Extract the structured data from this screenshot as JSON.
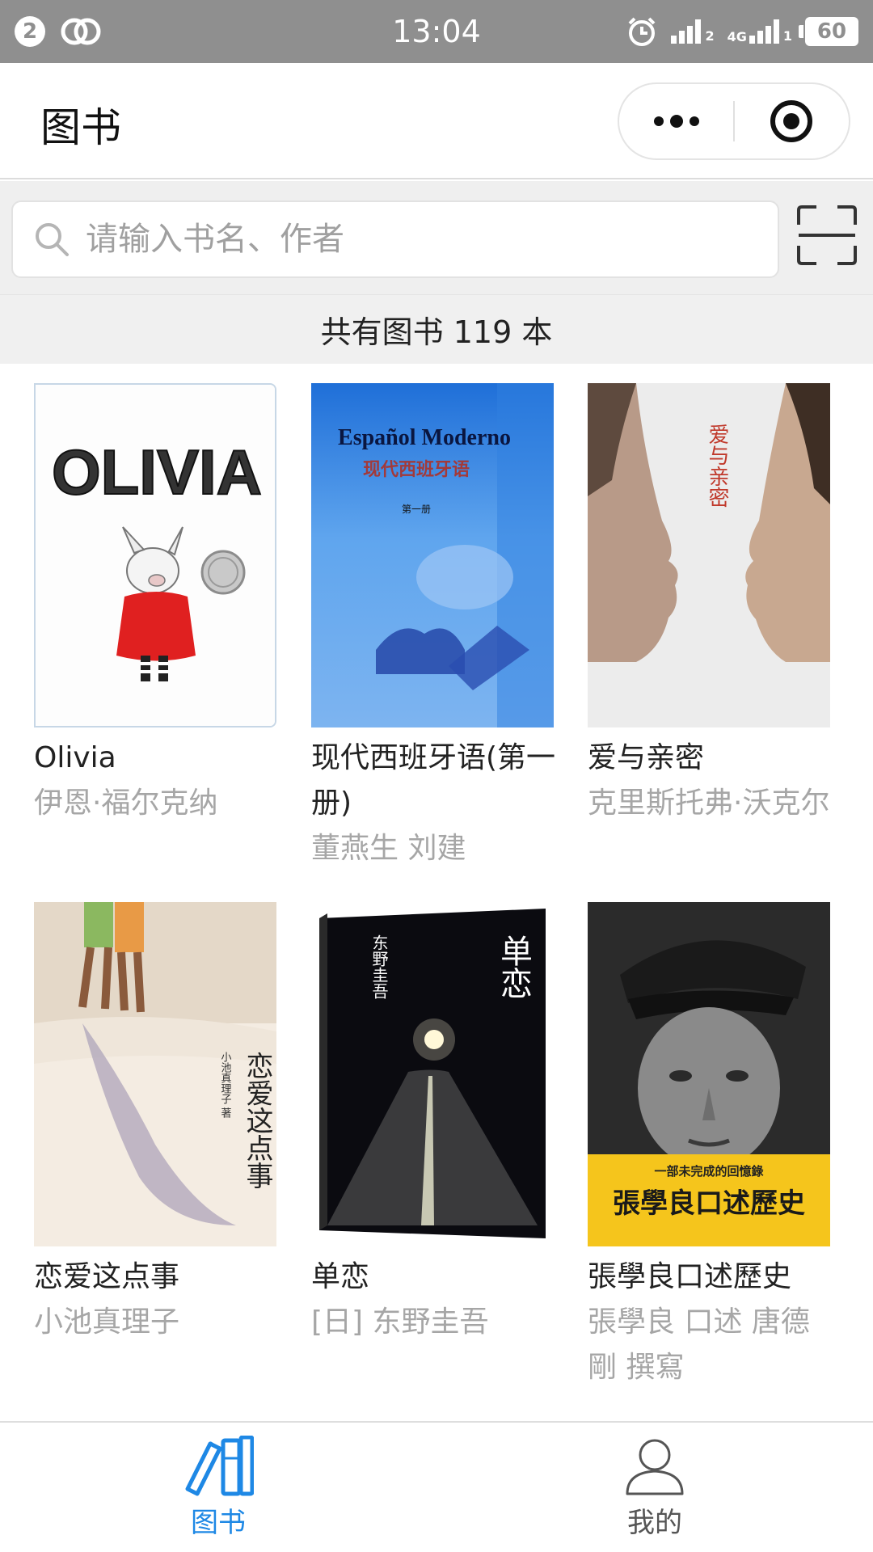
{
  "status_bar": {
    "notification_count": "2",
    "time": "13:04",
    "signal_1_label": "2",
    "signal_2_label": "1",
    "network": "4G",
    "battery": "60"
  },
  "nav": {
    "title": "图书"
  },
  "search": {
    "placeholder": "请输入书名、作者",
    "value": ""
  },
  "summary": {
    "count_text": "共有图书 119 本"
  },
  "books": [
    {
      "title": "Olivia",
      "author": "伊恩·福尔克纳"
    },
    {
      "title": "现代西班牙语(第一册)",
      "author": "董燕生 刘建"
    },
    {
      "title": "爱与亲密",
      "author": "克里斯托弗·沃克尔"
    },
    {
      "title": "恋爱这点事",
      "author": "小池真理子"
    },
    {
      "title": "单恋",
      "author": "[日] 东野圭吾"
    },
    {
      "title": "張學良口述歷史",
      "author": "張學良 口述 唐德剛 撰寫"
    }
  ],
  "covers": {
    "olivia": {
      "heading": "OLIVIA"
    },
    "spanish": {
      "heading": "Español Moderno",
      "subtitle": "现代西班牙语",
      "volume": "第一册"
    },
    "love": {
      "heading": "爱与亲密"
    },
    "lianai": {
      "heading": "恋爱这点事",
      "author": "小池真理子 著"
    },
    "danlian": {
      "heading": "单恋",
      "author": "东野圭吾"
    },
    "zhang": {
      "heading": "張學良口述歷史",
      "tagline": "一部未完成的回憶錄"
    }
  },
  "tabs": [
    {
      "label": "图书",
      "active": true
    },
    {
      "label": "我的",
      "active": false
    }
  ],
  "colors": {
    "accent": "#1e88e5",
    "status_bar": "#8f8f8f",
    "muted_text": "#a6a6a6",
    "page_bg": "#efefef"
  }
}
